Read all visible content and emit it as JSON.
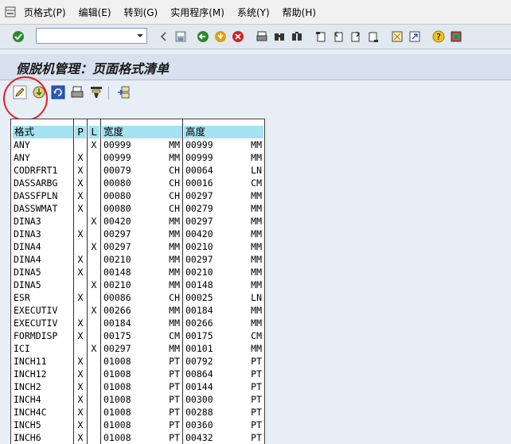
{
  "menubar": {
    "items": [
      "页格式(P)",
      "编辑(E)",
      "转到(G)",
      "实用程序(M)",
      "系统(Y)",
      "帮助(H)"
    ]
  },
  "toolbar": {
    "command_value": "",
    "icons": [
      "enter-icon",
      "back-icon",
      "exit-icon",
      "cancel-icon",
      "print-icon",
      "find-icon",
      "find-next-icon",
      "first-page-icon",
      "previous-page-icon",
      "next-page-icon",
      "last-page-icon",
      "new-session-icon",
      "shortcut-icon",
      "help-icon",
      "layout-icon"
    ]
  },
  "title": "假脱机管理：页面格式清单",
  "app_toolbar": {
    "icons": [
      "edit-pencil-icon",
      "download-icon",
      "refresh-icon",
      "print-icon",
      "filter-icon",
      "transport-icon"
    ]
  },
  "table": {
    "headers": {
      "format": "格式",
      "p": "P",
      "l": "L",
      "width": "宽度",
      "height": "高度"
    },
    "rows": [
      {
        "format": "ANY",
        "p": "",
        "l": "X",
        "width": "00999",
        "wunit": "MM",
        "height": "00999",
        "hunit": "MM"
      },
      {
        "format": "ANY",
        "p": "X",
        "l": "",
        "width": "00999",
        "wunit": "MM",
        "height": "00999",
        "hunit": "MM"
      },
      {
        "format": "CODRFRT1",
        "p": "X",
        "l": "",
        "width": "00079",
        "wunit": "CH",
        "height": "00064",
        "hunit": "LN"
      },
      {
        "format": "DASSARBG",
        "p": "X",
        "l": "",
        "width": "00080",
        "wunit": "CH",
        "height": "00016",
        "hunit": "CM"
      },
      {
        "format": "DASSFPLN",
        "p": "X",
        "l": "",
        "width": "00080",
        "wunit": "CH",
        "height": "00297",
        "hunit": "MM"
      },
      {
        "format": "DASSWMAT",
        "p": "X",
        "l": "",
        "width": "00080",
        "wunit": "CH",
        "height": "00279",
        "hunit": "MM"
      },
      {
        "format": "DINA3",
        "p": "",
        "l": "X",
        "width": "00420",
        "wunit": "MM",
        "height": "00297",
        "hunit": "MM"
      },
      {
        "format": "DINA3",
        "p": "X",
        "l": "",
        "width": "00297",
        "wunit": "MM",
        "height": "00420",
        "hunit": "MM"
      },
      {
        "format": "DINA4",
        "p": "",
        "l": "X",
        "width": "00297",
        "wunit": "MM",
        "height": "00210",
        "hunit": "MM"
      },
      {
        "format": "DINA4",
        "p": "X",
        "l": "",
        "width": "00210",
        "wunit": "MM",
        "height": "00297",
        "hunit": "MM"
      },
      {
        "format": "DINA5",
        "p": "X",
        "l": "",
        "width": "00148",
        "wunit": "MM",
        "height": "00210",
        "hunit": "MM"
      },
      {
        "format": "DINA5",
        "p": "",
        "l": "X",
        "width": "00210",
        "wunit": "MM",
        "height": "00148",
        "hunit": "MM"
      },
      {
        "format": "ESR",
        "p": "X",
        "l": "",
        "width": "00086",
        "wunit": "CH",
        "height": "00025",
        "hunit": "LN"
      },
      {
        "format": "EXECUTIV",
        "p": "",
        "l": "X",
        "width": "00266",
        "wunit": "MM",
        "height": "00184",
        "hunit": "MM"
      },
      {
        "format": "EXECUTIV",
        "p": "X",
        "l": "",
        "width": "00184",
        "wunit": "MM",
        "height": "00266",
        "hunit": "MM"
      },
      {
        "format": "FORMDISP",
        "p": "X",
        "l": "",
        "width": "00175",
        "wunit": "CM",
        "height": "00175",
        "hunit": "CM"
      },
      {
        "format": "ICI",
        "p": "",
        "l": "X",
        "width": "00297",
        "wunit": "MM",
        "height": "00101",
        "hunit": "MM"
      },
      {
        "format": "INCH11",
        "p": "X",
        "l": "",
        "width": "01008",
        "wunit": "PT",
        "height": "00792",
        "hunit": "PT"
      },
      {
        "format": "INCH12",
        "p": "X",
        "l": "",
        "width": "01008",
        "wunit": "PT",
        "height": "00864",
        "hunit": "PT"
      },
      {
        "format": "INCH2",
        "p": "X",
        "l": "",
        "width": "01008",
        "wunit": "PT",
        "height": "00144",
        "hunit": "PT"
      },
      {
        "format": "INCH4",
        "p": "X",
        "l": "",
        "width": "01008",
        "wunit": "PT",
        "height": "00300",
        "hunit": "PT"
      },
      {
        "format": "INCH4C",
        "p": "X",
        "l": "",
        "width": "01008",
        "wunit": "PT",
        "height": "00288",
        "hunit": "PT"
      },
      {
        "format": "INCH5",
        "p": "X",
        "l": "",
        "width": "01008",
        "wunit": "PT",
        "height": "00360",
        "hunit": "PT"
      },
      {
        "format": "INCH6",
        "p": "X",
        "l": "",
        "width": "01008",
        "wunit": "PT",
        "height": "00432",
        "hunit": "PT"
      }
    ]
  }
}
